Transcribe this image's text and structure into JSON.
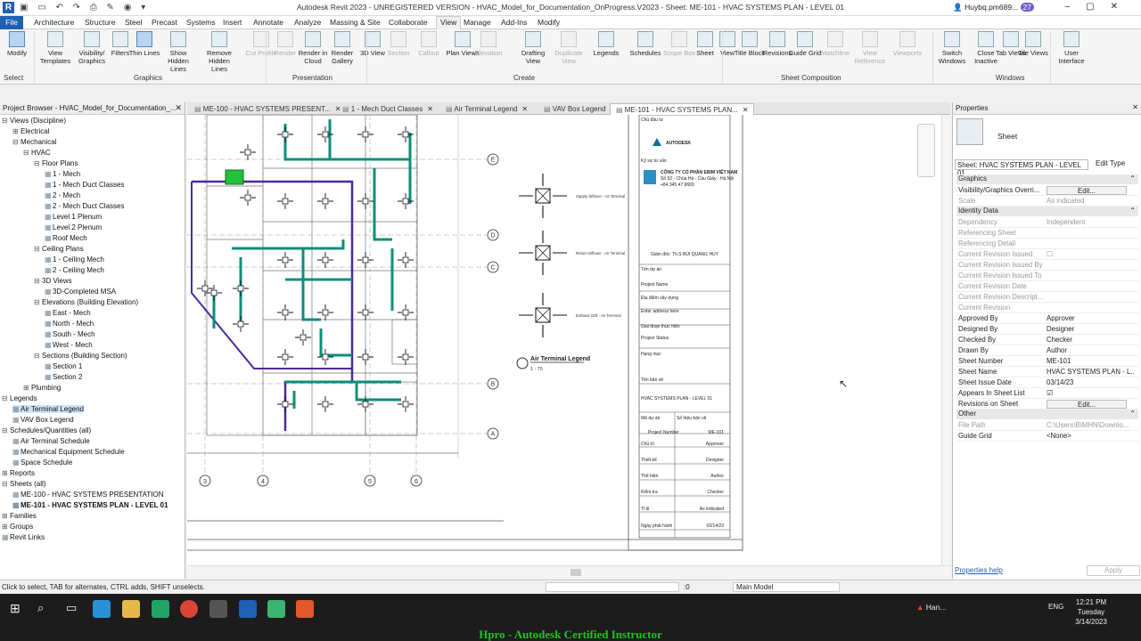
{
  "titlebar": {
    "app_title": "Autodesk Revit 2023 - UNREGISTERED VERSION - HVAC_Model_for_Documentation_OnProgress.V2023 - Sheet: ME-101 - HVAC SYSTEMS PLAN - LEVEL 01",
    "user": "Huybq.pm689...",
    "notif": "27"
  },
  "menu": [
    "File",
    "Architecture",
    "Structure",
    "Steel",
    "Precast",
    "Systems",
    "Insert",
    "Annotate",
    "Analyze",
    "Massing & Site",
    "Collaborate",
    "View",
    "Manage",
    "Add-Ins",
    "Modify"
  ],
  "ribbon": {
    "buttons": [
      {
        "label": "Modify",
        "state": "sel"
      },
      {
        "label": "View Templates",
        "state": ""
      },
      {
        "label": "Visibility/ Graphics",
        "state": ""
      },
      {
        "label": "Filters",
        "state": ""
      },
      {
        "label": "Thin Lines",
        "state": "sel"
      },
      {
        "label": "Show Hidden Lines",
        "state": ""
      },
      {
        "label": "Remove Hidden Lines",
        "state": ""
      },
      {
        "label": "Cut Profile",
        "state": "dis"
      },
      {
        "label": "Render",
        "state": "dis"
      },
      {
        "label": "Render in Cloud",
        "state": ""
      },
      {
        "label": "Render Gallery",
        "state": ""
      },
      {
        "label": "3D View",
        "state": ""
      },
      {
        "label": "Section",
        "state": "dis"
      },
      {
        "label": "Callout",
        "state": "dis"
      },
      {
        "label": "Plan Views",
        "state": ""
      },
      {
        "label": "Elevation",
        "state": "dis"
      },
      {
        "label": "Drafting View",
        "state": ""
      },
      {
        "label": "Duplicate View",
        "state": "dis"
      },
      {
        "label": "Legends",
        "state": ""
      },
      {
        "label": "Schedules",
        "state": ""
      },
      {
        "label": "Scope Box",
        "state": "dis"
      },
      {
        "label": "Sheet",
        "state": ""
      },
      {
        "label": "View",
        "state": ""
      },
      {
        "label": "Title Block",
        "state": ""
      },
      {
        "label": "Revisions",
        "state": ""
      },
      {
        "label": "Guide Grid",
        "state": ""
      },
      {
        "label": "Matchline",
        "state": "dis"
      },
      {
        "label": "View Reference",
        "state": "dis"
      },
      {
        "label": "Viewports",
        "state": "dis"
      },
      {
        "label": "Switch Windows",
        "state": ""
      },
      {
        "label": "Close Inactive",
        "state": ""
      },
      {
        "label": "Tab Views",
        "state": ""
      },
      {
        "label": "Tile Views",
        "state": ""
      },
      {
        "label": "User Interface",
        "state": ""
      }
    ],
    "groups": [
      "Select",
      "Graphics",
      "Presentation",
      "Create",
      "Sheet Composition",
      "Windows"
    ]
  },
  "tabs": [
    "ME-100 - HVAC SYSTEMS PRESENT...",
    "1 - Mech Duct Classes",
    "Air Terminal Legend",
    "VAV Box Legend",
    "ME-101 - HVAC SYSTEMS PLAN..."
  ],
  "browser": {
    "title": "Project Browser - HVAC_Model_for_Documentation_...",
    "nodes": [
      {
        "t": "Views (Discipline)",
        "d": 0,
        "e": "-"
      },
      {
        "t": "Electrical",
        "d": 1,
        "e": "+"
      },
      {
        "t": "Mechanical",
        "d": 1,
        "e": "-"
      },
      {
        "t": "HVAC",
        "d": 2,
        "e": "-"
      },
      {
        "t": "Floor Plans",
        "d": 3,
        "e": "-"
      },
      {
        "t": "1 - Mech",
        "d": 4,
        "e": ""
      },
      {
        "t": "1 - Mech Duct Classes",
        "d": 4,
        "e": ""
      },
      {
        "t": "2 - Mech",
        "d": 4,
        "e": ""
      },
      {
        "t": "2 - Mech Duct Classes",
        "d": 4,
        "e": ""
      },
      {
        "t": "Level 1 Plenum",
        "d": 4,
        "e": ""
      },
      {
        "t": "Level 2 Plenum",
        "d": 4,
        "e": ""
      },
      {
        "t": "Roof Mech",
        "d": 4,
        "e": ""
      },
      {
        "t": "Ceiling Plans",
        "d": 3,
        "e": "-"
      },
      {
        "t": "1 - Ceiling Mech",
        "d": 4,
        "e": ""
      },
      {
        "t": "2 - Ceiling Mech",
        "d": 4,
        "e": ""
      },
      {
        "t": "3D Views",
        "d": 3,
        "e": "-"
      },
      {
        "t": "3D-Completed MSA",
        "d": 4,
        "e": ""
      },
      {
        "t": "Elevations (Building Elevation)",
        "d": 3,
        "e": "-"
      },
      {
        "t": "East - Mech",
        "d": 4,
        "e": ""
      },
      {
        "t": "North - Mech",
        "d": 4,
        "e": ""
      },
      {
        "t": "South - Mech",
        "d": 4,
        "e": ""
      },
      {
        "t": "West - Mech",
        "d": 4,
        "e": ""
      },
      {
        "t": "Sections (Building Section)",
        "d": 3,
        "e": "-"
      },
      {
        "t": "Section 1",
        "d": 4,
        "e": ""
      },
      {
        "t": "Section 2",
        "d": 4,
        "e": ""
      },
      {
        "t": "Plumbing",
        "d": 2,
        "e": "+"
      },
      {
        "t": "Legends",
        "d": 0,
        "e": "-"
      },
      {
        "t": "Air Terminal Legend",
        "d": 1,
        "e": "",
        "sel": true
      },
      {
        "t": "VAV Box Legend",
        "d": 1,
        "e": ""
      },
      {
        "t": "Schedules/Quantities (all)",
        "d": 0,
        "e": "-"
      },
      {
        "t": "Air Terminal Schedule",
        "d": 1,
        "e": ""
      },
      {
        "t": "Mechanical Equipment Schedule",
        "d": 1,
        "e": ""
      },
      {
        "t": "Space Schedule",
        "d": 1,
        "e": ""
      },
      {
        "t": "Reports",
        "d": 0,
        "e": "+"
      },
      {
        "t": "Sheets (all)",
        "d": 0,
        "e": "-"
      },
      {
        "t": "ME-100 - HVAC SYSTEMS PRESENTATION",
        "d": 1,
        "e": ""
      },
      {
        "t": "ME-101 - HVAC SYSTEMS PLAN - LEVEL 01",
        "d": 1,
        "e": "",
        "bold": true
      },
      {
        "t": "Families",
        "d": 0,
        "e": "+"
      },
      {
        "t": "Groups",
        "d": 0,
        "e": "+"
      },
      {
        "t": "Revit Links",
        "d": 0,
        "e": ""
      }
    ]
  },
  "sheet": {
    "legend_items": [
      "Supply Diffuser - Air Terminal",
      "Return Diffuser - Air Terminal",
      "Exhaust Grill - Air Terminal"
    ],
    "legend_title": "Air Terminal Legend",
    "legend_scale": "1 : 75",
    "grid_h": [
      "E",
      "D",
      "C",
      "B",
      "A"
    ],
    "grid_v": [
      "3",
      "4",
      "5",
      "6"
    ],
    "tb": {
      "owner": "Chủ đầu tư",
      "brand": "AUTODESK",
      "consultant": "Kỹ sư tư vấn",
      "company": "CÔNG TY CỔ PHẦN EBIM VIỆT NAM",
      "address": "Số 52 - Chùa Hà - Cầu Giấy - Hà Nội",
      "phone": "+84 345 47 9669",
      "director": "Giám đốc: Th.S BÙI QUANG HUY",
      "proj_label": "Tên dự án",
      "proj_val": "Project Name",
      "loc_label": "Địa điểm xây dựng",
      "loc_val": "Enter address here",
      "phase_label": "Giai đoạn thực hiện",
      "phase_val": "Project Status",
      "item_label": "Hạng mục",
      "drw_label": "Tên bản vẽ",
      "drw_val": "HVAC SYSTEMS PLAN - LEVEL 01",
      "pnum_label": "Mã dự án",
      "pnum_val": "Project Number",
      "snum_label": "Số hiệu bản vẽ",
      "snum_val": "ME-101",
      "r1": "Chủ trì",
      "r1v": "Approver",
      "r2": "Thiết kế",
      "r2v": "Designer",
      "r3": "Thể hiện",
      "r3v": "Author",
      "r4": "Kiểm tra",
      "r4v": "Checker",
      "r5": "Tỉ lệ",
      "r5v": "As indicated",
      "r6": "Ngày phát hành",
      "r6v": "03/14/23"
    }
  },
  "props": {
    "title": "Properties",
    "type": "Sheet",
    "selector": "Sheet: HVAC SYSTEMS PLAN - LEVEL 01",
    "edit_type": "Edit Type",
    "rows": [
      {
        "s": "Graphics"
      },
      {
        "k": "Visibility/Graphics Overri...",
        "v": "Edit...",
        "btn": true
      },
      {
        "k": "Scale",
        "v": "As indicated",
        "g": true
      },
      {
        "s": "Identity Data"
      },
      {
        "k": "Dependency",
        "v": "Independent",
        "g": true
      },
      {
        "k": "Referencing Sheet",
        "v": "",
        "g": true
      },
      {
        "k": "Referencing Detail",
        "v": "",
        "g": true
      },
      {
        "k": "Current Revision Issued",
        "v": "",
        "g": true,
        "cb": true
      },
      {
        "k": "Current Revision Issued By",
        "v": "",
        "g": true
      },
      {
        "k": "Current Revision Issued To",
        "v": "",
        "g": true
      },
      {
        "k": "Current Revision Date",
        "v": "",
        "g": true
      },
      {
        "k": "Current Revision Descript...",
        "v": "",
        "g": true
      },
      {
        "k": "Current Revision",
        "v": "",
        "g": true
      },
      {
        "k": "Approved By",
        "v": "Approver"
      },
      {
        "k": "Designed By",
        "v": "Designer"
      },
      {
        "k": "Checked By",
        "v": "Checker"
      },
      {
        "k": "Drawn By",
        "v": "Author"
      },
      {
        "k": "Sheet Number",
        "v": "ME-101"
      },
      {
        "k": "Sheet Name",
        "v": "HVAC SYSTEMS PLAN - L..."
      },
      {
        "k": "Sheet Issue Date",
        "v": "03/14/23"
      },
      {
        "k": "Appears In Sheet List",
        "v": "",
        "cb": true,
        "checked": true
      },
      {
        "k": "Revisions on Sheet",
        "v": "Edit...",
        "btn": true
      },
      {
        "s": "Other"
      },
      {
        "k": "File Path",
        "v": "C:\\Users\\BIMHN\\Downlo...",
        "g": true
      },
      {
        "k": "Guide Grid",
        "v": "<None>"
      }
    ],
    "help": "Properties help",
    "apply": "Apply"
  },
  "status": {
    "hint": "Click to select, TAB for alternates, CTRL adds, SHIFT unselects.",
    "count": ":0",
    "model": "Main Model"
  },
  "taskbar": {
    "app": "Han...",
    "lang": "ENG",
    "time": "12:21 PM",
    "day": "Tuesday",
    "date": "3/14/2023"
  },
  "caption": "Hpro - Autodesk Certified Instructor",
  "colors": {
    "accent": "#1f5fb4",
    "supply": "#0b8f7a",
    "return": "#4b2b9e",
    "grid": "#555555",
    "highlight": "#ffff3a"
  }
}
